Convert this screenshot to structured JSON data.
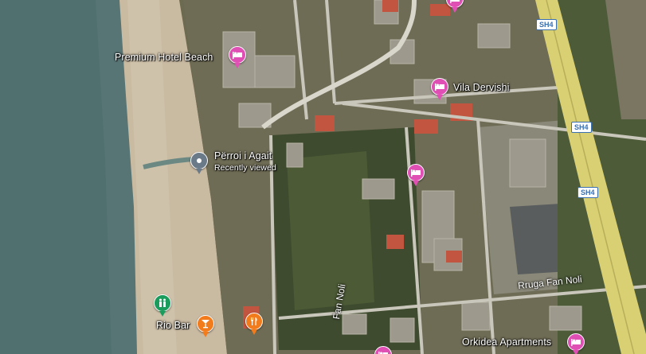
{
  "places": {
    "premium_hotel": "Premium Hotel Beach",
    "vila_dervishi": "Vila Dervishi",
    "perroi": "Përroi i Agait",
    "recently_viewed": "Recently viewed",
    "rio_bar": "Rio Bar",
    "orkidea": "Orkidea Apartments"
  },
  "roads": {
    "fan_noli_1": "Rruga Fan Noli",
    "fan_noli_2": "Fan Noli",
    "sh4": "SH4"
  },
  "icons": {
    "hotel": "hotel-bed-icon",
    "food": "restaurant-icon",
    "bar": "cocktail-icon",
    "park": "park-icon",
    "place": "place-pin-icon"
  },
  "colors": {
    "sea": "#587575",
    "sand": "#c7b9a1",
    "highway": "#d6cc72",
    "hotel_pin": "#e04fb4",
    "food_pin": "#f27b1c",
    "park_pin": "#1a9c5d"
  }
}
